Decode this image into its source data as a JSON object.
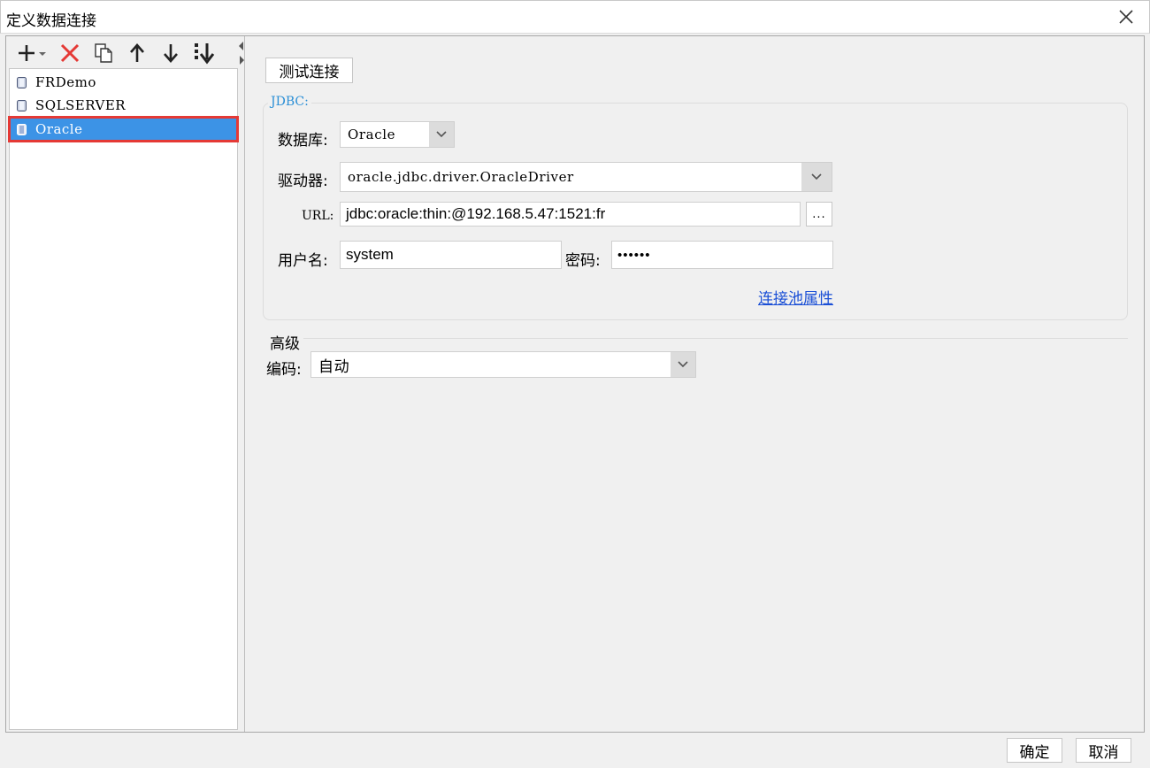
{
  "window": {
    "title": "定义数据连接"
  },
  "toolbar": {
    "icons": [
      "add-icon",
      "delete-icon",
      "copy-icon",
      "move-up-icon",
      "move-down-icon",
      "sort-icon"
    ]
  },
  "connections": {
    "items": [
      {
        "label": "FRDemo"
      },
      {
        "label": "SQLSERVER"
      },
      {
        "label": "Oracle",
        "selected": true
      }
    ]
  },
  "form": {
    "test_button": "测试连接",
    "group_label": "JDBC:",
    "database_label": "数据库:",
    "database_value": "Oracle",
    "driver_label": "驱动器:",
    "driver_value": "oracle.jdbc.driver.OracleDriver",
    "url_label": "URL:",
    "url_value": "jdbc:oracle:thin:@192.168.5.47:1521:fr",
    "url_browse": "...",
    "username_label": "用户名:",
    "username_value": "system",
    "password_label": "密码:",
    "password_value": "••••••",
    "pool_link": "连接池属性",
    "advanced_label": "高级",
    "encoding_label": "编码:",
    "encoding_value": "自动"
  },
  "footer": {
    "ok": "确定",
    "cancel": "取消"
  },
  "colors": {
    "selection": "#3c93e6",
    "highlight_border": "#e53935",
    "legend": "#2b8fd6",
    "link": "#1a4fd6"
  }
}
